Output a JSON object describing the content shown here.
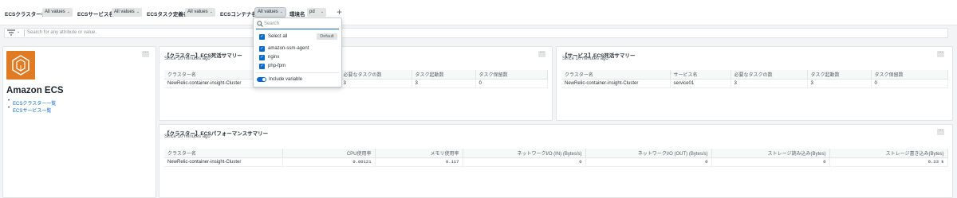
{
  "variables": [
    {
      "label": "ECSクラスター名",
      "value": "All values"
    },
    {
      "label": "ECSサービス名",
      "value": "All values"
    },
    {
      "label": "ECSタスク定義名",
      "value": "All values"
    },
    {
      "label": "ECSコンテナ名",
      "value": "All values"
    },
    {
      "label": "環境名",
      "value": "pd"
    }
  ],
  "add_variable": "+",
  "filter": {
    "placeholder": "Search for any attribute or value."
  },
  "dropdown": {
    "search_placeholder": "Search",
    "select_all": "Select all",
    "default_badge": "Default",
    "items": [
      "amazon-ssm-agent",
      "nginx",
      "php-fpm"
    ],
    "include_variable": "Include variable"
  },
  "logo_widget": {
    "title": "Amazon ECS",
    "links": [
      "ECSクラスター一覧",
      "ECSサービス一覧"
    ]
  },
  "cluster_summary": {
    "title": "【クラスター】ECS死活サマリー",
    "subtitle": "Since 10 minutes ago",
    "columns": [
      "クラスター名",
      "必要なタスクの数",
      "タスク起動数",
      "タスク保留数"
    ],
    "rows": [
      [
        "NewRelic-container-insight-Cluster",
        "3",
        "3",
        "0"
      ]
    ]
  },
  "service_summary": {
    "title": "【サービス】ECS死活サマリー",
    "subtitle": "Since 10 minutes ago",
    "columns": [
      "クラスター名",
      "サービス名",
      "必要なタスクの数",
      "タスク起動数",
      "タスク保留数"
    ],
    "rows": [
      [
        "NewRelic-container-insight-Cluster",
        "service01",
        "3",
        "3",
        "0"
      ]
    ]
  },
  "performance_summary": {
    "title": "【クラスター】ECSパフォーマンスサマリー",
    "subtitle": "Since 10 minutes ago",
    "columns": [
      "クラスター名",
      "CPU使用率",
      "メモリ使用率",
      "ネットワークI/O (IN) (Bytes/s)",
      "ネットワークI/O (OUT) (Bytes/s)",
      "ストレージ読み込み(Bytes)",
      "ストレージ書き込み(Bytes)"
    ],
    "rows": [
      [
        "NewRelic-container-insight-Cluster",
        "0.00121",
        "0.117",
        "0",
        "0",
        "0",
        "0.33 k"
      ]
    ]
  },
  "menu_glyph": "···",
  "colors": {
    "accent": "#0b6acb",
    "ecs_orange": "#e07b24"
  }
}
